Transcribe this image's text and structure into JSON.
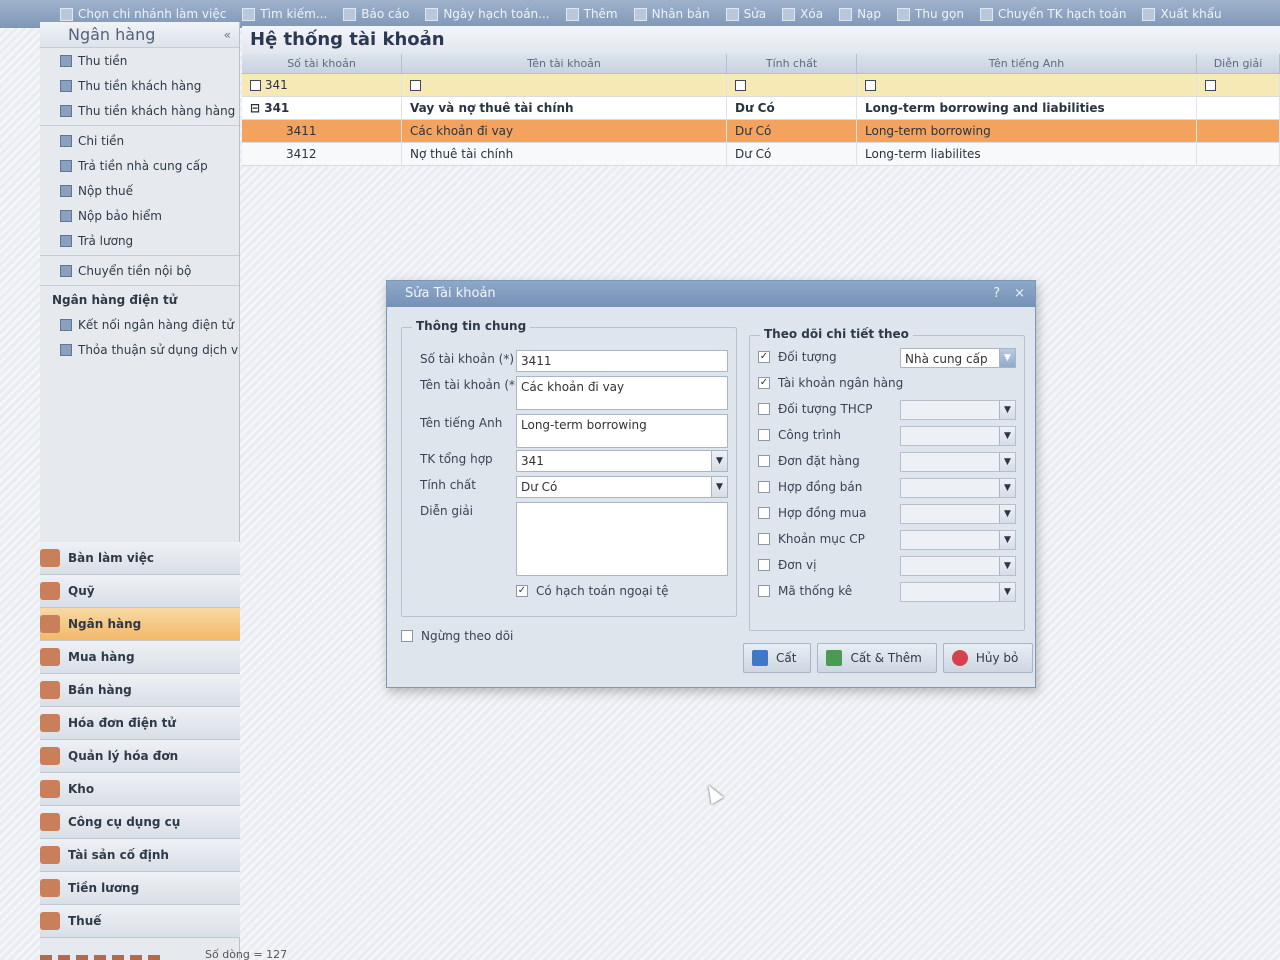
{
  "toolbar": {
    "items": [
      {
        "label": "Chọn chi nhánh làm việc",
        "icon": "branch-icon"
      },
      {
        "label": "Tìm kiếm...",
        "icon": "search-icon"
      },
      {
        "label": "Báo cáo",
        "icon": "report-icon"
      },
      {
        "label": "Ngày hạch toán...",
        "icon": "calendar-icon"
      },
      {
        "label": "Thêm",
        "icon": "add-icon"
      },
      {
        "label": "Nhân bản",
        "icon": "duplicate-icon"
      },
      {
        "label": "Sửa",
        "icon": "edit-icon"
      },
      {
        "label": "Xóa",
        "icon": "delete-icon"
      },
      {
        "label": "Nạp",
        "icon": "reload-icon"
      },
      {
        "label": "Thu gọn",
        "icon": "collapse-icon"
      },
      {
        "label": "Chuyển TK hạch toán",
        "icon": "transfer-icon"
      },
      {
        "label": "Xuất khẩu",
        "icon": "export-icon"
      }
    ]
  },
  "sidebar": {
    "title": "Ngân hàng",
    "collapse": "«",
    "items_top": [
      "Thu tiền",
      "Thu tiền khách hàng",
      "Thu tiền khách hàng hàng l..."
    ],
    "items_mid": [
      "Chi tiền",
      "Trả tiền nhà cung cấp",
      "Nộp thuế",
      "Nộp bảo hiểm",
      "Trả lương"
    ],
    "item_transfer": "Chuyển tiền nội bộ",
    "group_ebank": "Ngân hàng điện tử",
    "items_ebank": [
      "Kết nối ngân hàng điện tử",
      "Thỏa thuận sử dụng dịch vụ"
    ],
    "modules": [
      "Bàn làm việc",
      "Quỹ",
      "Ngân hàng",
      "Mua hàng",
      "Bán hàng",
      "Hóa đơn điện tử",
      "Quản lý hóa đơn",
      "Kho",
      "Công cụ dụng cụ",
      "Tài sản cố định",
      "Tiền lương",
      "Thuế"
    ],
    "active_module": "Ngân hàng"
  },
  "status": {
    "text": "Số dòng = 127"
  },
  "main": {
    "title": "Hệ thống tài khoản",
    "columns": [
      "Số tài khoản",
      "Tên tài khoản",
      "Tính chất",
      "Tên tiếng Anh",
      "Diễn giải"
    ],
    "filter_account": "341",
    "rows": [
      {
        "account": "341",
        "name": "Vay và nợ thuê tài chính",
        "nature": "Dư Có",
        "english": "Long-term borrowing and liabilities"
      },
      {
        "account": "3411",
        "name": "Các khoản đi vay",
        "nature": "Dư Có",
        "english": "Long-term borrowing"
      },
      {
        "account": "3412",
        "name": "Nợ thuê tài chính",
        "nature": "Dư Có",
        "english": "Long-term liabilites"
      }
    ]
  },
  "dialog": {
    "title": "Sửa Tài khoản",
    "help": "?",
    "close": "×",
    "general": {
      "legend": "Thông tin chung",
      "account_no_label": "Số tài khoản (*)",
      "account_no_value": "3411",
      "account_name_label": "Tên tài khoản (*)",
      "account_name_value": "Các khoản đi vay",
      "english_label": "Tên tiếng Anh",
      "english_value": "Long-term borrowing",
      "parent_label": "TK tổng hợp",
      "parent_value": "341",
      "nature_label": "Tính chất",
      "nature_value": "Dư Có",
      "desc_label": "Diễn giải",
      "desc_value": "",
      "foreign_label": "Có hạch toán ngoại tệ",
      "foreign_checked": true
    },
    "stop_tracking_label": "Ngừng theo dõi",
    "tracking": {
      "legend": "Theo dõi chi tiết theo",
      "options": [
        {
          "label": "Đối tượng",
          "checked": true,
          "combo": "Nhà cung cấp"
        },
        {
          "label": "Tài khoản ngân hàng",
          "checked": true,
          "combo": null
        },
        {
          "label": "Đối tượng THCP",
          "checked": false,
          "combo": ""
        },
        {
          "label": "Công trình",
          "checked": false,
          "combo": ""
        },
        {
          "label": "Đơn đặt hàng",
          "checked": false,
          "combo": ""
        },
        {
          "label": "Hợp đồng bán",
          "checked": false,
          "combo": ""
        },
        {
          "label": "Hợp đồng mua",
          "checked": false,
          "combo": ""
        },
        {
          "label": "Khoản mục CP",
          "checked": false,
          "combo": ""
        },
        {
          "label": "Đơn vị",
          "checked": false,
          "combo": ""
        },
        {
          "label": "Mã thống kê",
          "checked": false,
          "combo": ""
        }
      ]
    },
    "buttons": {
      "save": "Cất",
      "save_add": "Cất & Thêm",
      "cancel": "Hủy bỏ"
    }
  }
}
